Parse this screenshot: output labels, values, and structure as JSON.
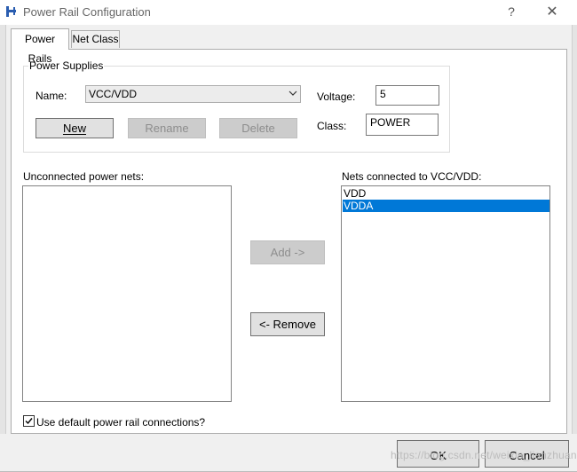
{
  "window": {
    "title": "Power Rail Configuration",
    "help_glyph": "?",
    "close_glyph": "✕"
  },
  "tabs": [
    {
      "label": "Power Rails",
      "active": true
    },
    {
      "label": "Net Class",
      "active": false
    }
  ],
  "power_supplies": {
    "group_label": "Power Supplies",
    "name_label": "Name:",
    "name_value": "VCC/VDD",
    "voltage_label": "Voltage:",
    "voltage_value": "5",
    "class_label": "Class:",
    "class_value": "POWER",
    "buttons": {
      "new_label": "New",
      "rename_label": "Rename",
      "delete_label": "Delete"
    }
  },
  "unconnected": {
    "label": "Unconnected power nets:",
    "items": []
  },
  "connected": {
    "label": "Nets connected to VCC/VDD:",
    "items": [
      {
        "name": "VDD",
        "selected": false
      },
      {
        "name": "VDDA",
        "selected": true
      }
    ]
  },
  "actions": {
    "add_label": "Add ->",
    "remove_label": "<- Remove"
  },
  "use_default": {
    "label": "Use default power rail connections?",
    "checked": true
  },
  "footer": {
    "ok_label": "OK",
    "cancel_label": "Cancel",
    "watermark": "https://blog.csdn.net/weixin_lianzhuang"
  },
  "colors": {
    "selection": "#0078d7",
    "disabled_text": "#8d8d8d"
  }
}
